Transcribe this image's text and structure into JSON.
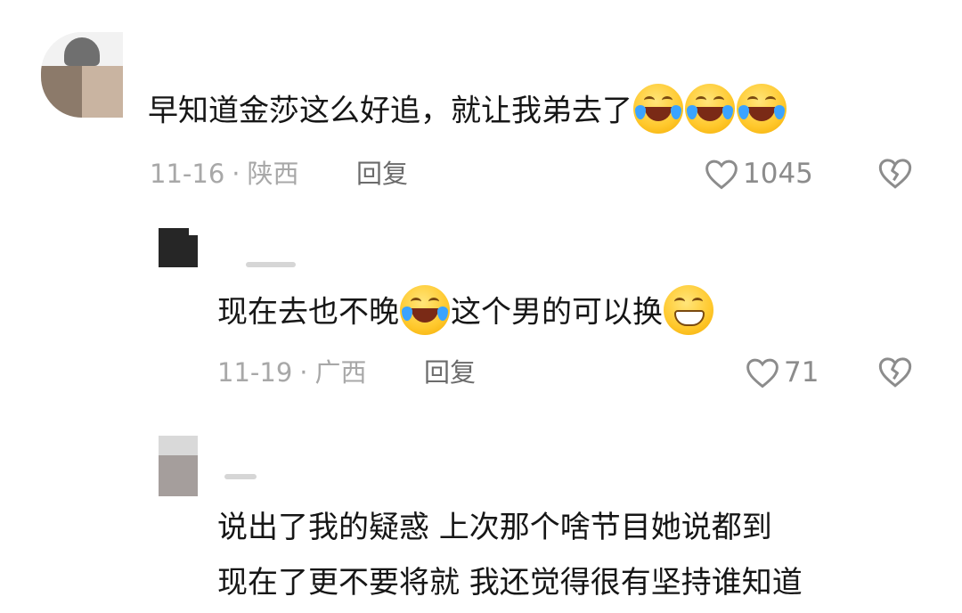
{
  "comments": [
    {
      "text_before": "早知道金莎这么好追，就让我弟去了",
      "emoji_after": [
        "grinning-squinting-tears-icon",
        "grinning-squinting-tears-icon",
        "grinning-squinting-tears-icon"
      ],
      "date": "11-16",
      "location": "陕西",
      "reply_label": "回复",
      "likes": "1045"
    },
    {
      "text_part1": "现在去也不晚",
      "text_part2": "这个男的可以换",
      "date": "11-19",
      "location": "广西",
      "reply_label": "回复",
      "likes": "71"
    },
    {
      "line1": "说出了我的疑惑  上次那个啥节目她说都到",
      "line2": "现在了更不要将就 我还觉得很有坚持谁知道"
    }
  ],
  "meta_separator": "·",
  "colors": {
    "text": "#161616",
    "meta": "#a8a8a8",
    "icon": "#8c8c8c",
    "emoji": "#ffc82c"
  }
}
